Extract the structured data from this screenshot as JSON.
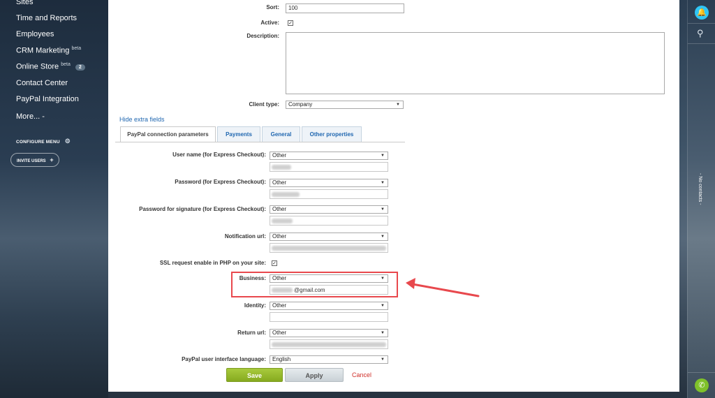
{
  "sidebar": {
    "items": [
      {
        "label": "Sites"
      },
      {
        "label": "Time and Reports"
      },
      {
        "label": "Employees"
      },
      {
        "label": "CRM Marketing",
        "sup": "beta"
      },
      {
        "label": "Online Store",
        "sup": "beta",
        "badge": "2"
      },
      {
        "label": "Contact Center"
      },
      {
        "label": "PayPal Integration"
      },
      {
        "label": "More... -"
      }
    ],
    "configure_menu": "CONFIGURE MENU",
    "invite_users": "INVITE USERS"
  },
  "form": {
    "sort_label": "Sort:",
    "sort_value": "100",
    "active_label": "Active:",
    "active_checked": true,
    "description_label": "Description:",
    "client_type_label": "Client type:",
    "client_type_value": "Company",
    "hide_extra_fields": "Hide extra fields"
  },
  "tabs": [
    {
      "label": "PayPal connection parameters",
      "active": true
    },
    {
      "label": "Payments"
    },
    {
      "label": "General"
    },
    {
      "label": "Other properties"
    }
  ],
  "fields": {
    "user_name_label": "User name (for Express Checkout):",
    "user_name_select": "Other",
    "password_label": "Password (for Express Checkout):",
    "password_select": "Other",
    "signature_label": "Password for signature (for Express Checkout):",
    "signature_select": "Other",
    "notification_label": "Notification url:",
    "notification_select": "Other",
    "ssl_label": "SSL request enable in PHP on your site:",
    "ssl_checked": true,
    "business_label": "Business:",
    "business_select": "Other",
    "business_value": "@gmail.com",
    "identity_label": "Identity:",
    "identity_select": "Other",
    "return_label": "Return url:",
    "return_select": "Other",
    "language_label": "PayPal user interface language:",
    "language_value": "English"
  },
  "buttons": {
    "save": "Save",
    "apply": "Apply",
    "cancel": "Cancel"
  },
  "rail": {
    "no_contacts": "- No contacts -"
  },
  "colors": {
    "accent_link": "#2067b0",
    "save_green": "#95b82b",
    "highlight_red": "#e8484d",
    "notify_blue": "#2fc6f6",
    "phone_green": "#7fc12a"
  },
  "icons": {
    "configure": "gear-icon",
    "invite": "plus-icon",
    "notifications": "bell-icon",
    "search": "search-icon",
    "phone": "phone-icon"
  }
}
